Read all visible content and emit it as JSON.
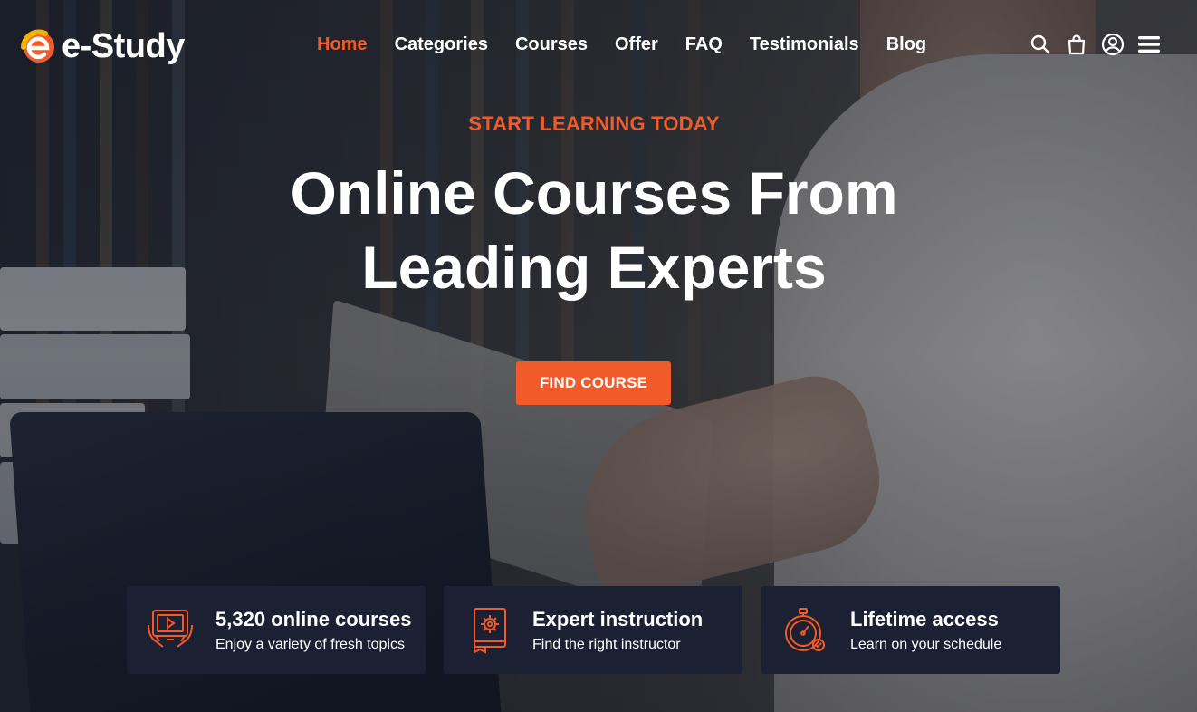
{
  "colors": {
    "accent": "#f15a29",
    "logo_yellow": "#f5b301",
    "card_bg": "#1b2132",
    "text": "#ffffff"
  },
  "brand": {
    "name": "e-Study"
  },
  "nav": {
    "items": [
      {
        "label": "Home",
        "active": true
      },
      {
        "label": "Categories",
        "active": false
      },
      {
        "label": "Courses",
        "active": false
      },
      {
        "label": "Offer",
        "active": false
      },
      {
        "label": "FAQ",
        "active": false
      },
      {
        "label": "Testimonials",
        "active": false
      },
      {
        "label": "Blog",
        "active": false
      }
    ]
  },
  "header_icons": [
    "search-icon",
    "cart-icon",
    "account-icon",
    "menu-icon"
  ],
  "hero": {
    "kicker": "START LEARNING TODAY",
    "headline_line1": "Online Courses From",
    "headline_line2": "Leading Experts",
    "cta_label": "FIND COURSE"
  },
  "features": [
    {
      "icon": "tablet-video-icon",
      "title": "5,320 online courses",
      "subtitle": "Enjoy a variety of fresh topics"
    },
    {
      "icon": "gear-book-icon",
      "title": "Expert instruction",
      "subtitle": "Find the right instructor"
    },
    {
      "icon": "stopwatch-icon",
      "title": "Lifetime access",
      "subtitle": "Learn on your schedule"
    }
  ]
}
